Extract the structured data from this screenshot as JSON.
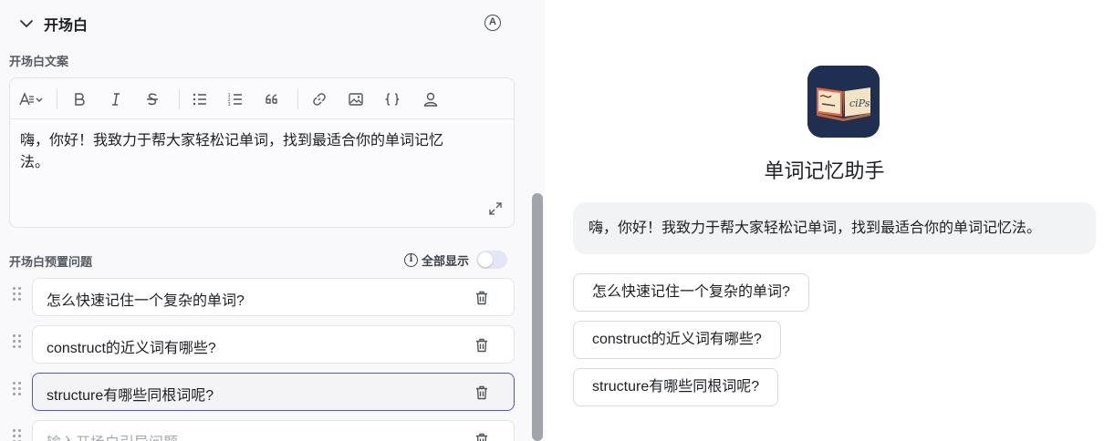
{
  "section": {
    "title": "开场白",
    "collapse_icon": "chevron-down-icon",
    "auto_icon_text": "A"
  },
  "opening_text": {
    "label": "开场白文案",
    "toolbar": [
      "text-style-icon",
      "bold-icon",
      "italic-icon",
      "strikethrough-icon",
      "bullet-list-icon",
      "numbered-list-icon",
      "quote-icon",
      "link-icon",
      "image-icon",
      "code-braces-icon",
      "user-icon"
    ],
    "content_line1": "嗨，你好！我致力于帮大家轻松记单词，找到最适合你的单词记忆",
    "content_line2": "法。"
  },
  "preset_questions": {
    "label": "开场白预置问题",
    "show_all_label": "全部显示",
    "show_all_on": false,
    "items": [
      "怎么快速记住一个复杂的单词?",
      "construct的近义词有哪些?",
      "structure有哪些同根词呢?"
    ],
    "new_placeholder": "输入开场白引导问题"
  },
  "preview": {
    "bot_name": "单词记忆助手",
    "greeting": "嗨，你好！我致力于帮大家轻松记单词，找到最适合你的单词记忆法。",
    "suggestions": [
      "怎么快速记住一个复杂的单词?",
      "construct的近义词有哪些?",
      "structure有哪些同根词呢?"
    ]
  },
  "colors": {
    "accent": "#4d53e8",
    "panel_bg": "#f9f9fb",
    "avatar_bg": "#1e2f52"
  }
}
